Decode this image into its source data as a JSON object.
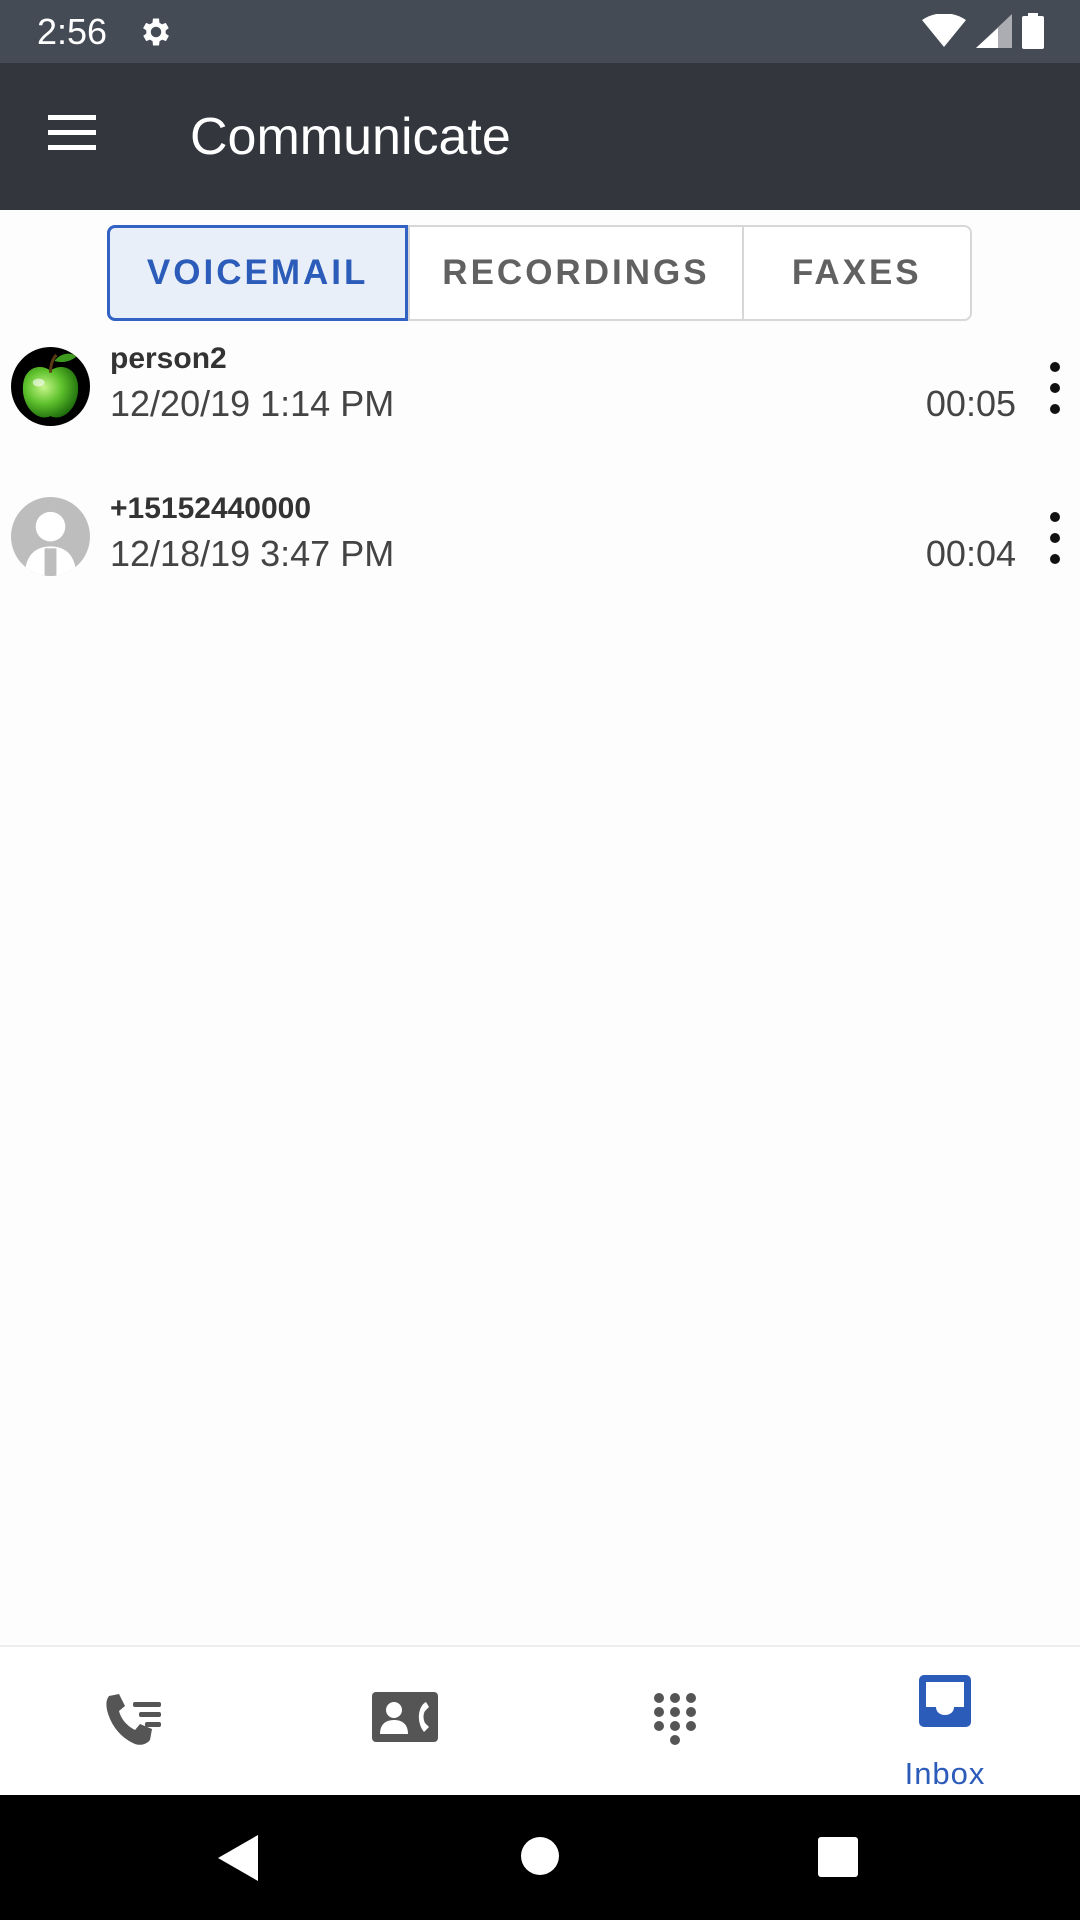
{
  "status_bar": {
    "time": "2:56",
    "icons": [
      "settings-icon",
      "wifi-icon",
      "cell-signal-icon",
      "battery-icon"
    ]
  },
  "app_bar": {
    "title": "Communicate",
    "menu_icon": "hamburger-menu-icon"
  },
  "tabs": [
    {
      "label": "VOICEMAIL",
      "selected": true
    },
    {
      "label": "RECORDINGS",
      "selected": false
    },
    {
      "label": "FAXES",
      "selected": false
    }
  ],
  "voicemails": [
    {
      "name": "person2",
      "datetime": "12/20/19 1:14 PM",
      "duration": "00:05",
      "avatar": "green-apple-avatar"
    },
    {
      "name": "+15152440000",
      "datetime": "12/18/19 3:47 PM",
      "duration": "00:04",
      "avatar": "default-person-avatar"
    }
  ],
  "bottom_nav": [
    {
      "icon": "call-history-icon",
      "label": ""
    },
    {
      "icon": "contacts-icon",
      "label": ""
    },
    {
      "icon": "dialpad-icon",
      "label": ""
    },
    {
      "icon": "inbox-icon",
      "label": "Inbox",
      "active": true
    }
  ],
  "colors": {
    "status_bar": "#454b55",
    "app_bar": "#33373d",
    "accent": "#2c5cba",
    "tab_active_bg": "#e9eff9"
  }
}
